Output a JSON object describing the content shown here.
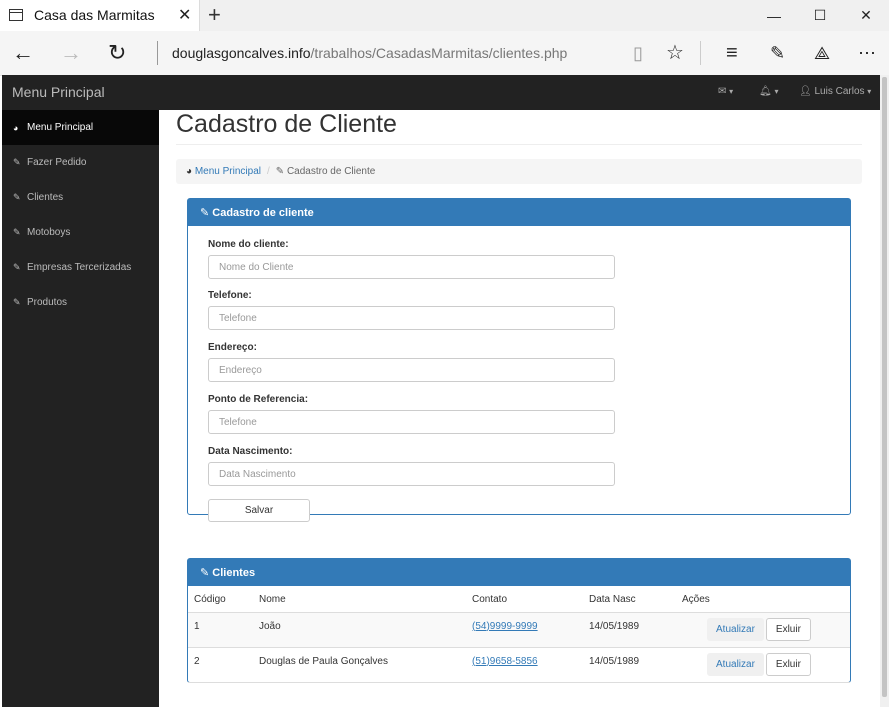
{
  "browser": {
    "tab_title": "Casa das Marmitas",
    "address_host": "douglasgoncalves.info",
    "address_path": "/trabalhos/CasadasMarmitas/clientes.php"
  },
  "topbar": {
    "brand": "Menu Principal",
    "user_name": "Luis Carlos"
  },
  "sidebar": {
    "items": [
      {
        "label": "Menu Principal",
        "icon": "dashboard-icon"
      },
      {
        "label": "Fazer Pedido",
        "icon": "edit-icon"
      },
      {
        "label": "Clientes",
        "icon": "edit-icon"
      },
      {
        "label": "Motoboys",
        "icon": "edit-icon"
      },
      {
        "label": "Empresas Tercerizadas",
        "icon": "edit-icon"
      },
      {
        "label": "Produtos",
        "icon": "edit-icon"
      }
    ]
  },
  "page": {
    "title": "Cadastro de Cliente",
    "breadcrumb_home": "Menu Principal",
    "breadcrumb_current": "Cadastro de Cliente"
  },
  "form": {
    "panel_title": "Cadastro de cliente",
    "fields": [
      {
        "label": "Nome do cliente:",
        "placeholder": "Nome do Cliente"
      },
      {
        "label": "Telefone:",
        "placeholder": "Telefone"
      },
      {
        "label": "Endereço:",
        "placeholder": "Endereço"
      },
      {
        "label": "Ponto de Referencia:",
        "placeholder": "Telefone"
      },
      {
        "label": "Data Nascimento:",
        "placeholder": "Data Nascimento"
      }
    ],
    "save_label": "Salvar"
  },
  "clients": {
    "panel_title": "Clientes",
    "columns": [
      "Código",
      "Nome",
      "Contato",
      "Data Nasc",
      "Ações"
    ],
    "rows": [
      {
        "code": "1",
        "name": "João",
        "contact": "(54)9999-9999",
        "birth": "14/05/1989"
      },
      {
        "code": "2",
        "name": "Douglas de Paula Gonçalves",
        "contact": "(51)9658-5856",
        "birth": "14/05/1989"
      }
    ],
    "update_label": "Atualizar",
    "delete_label": "Exluir"
  },
  "colors": {
    "primary": "#337ab7",
    "sidebar_bg": "#222222",
    "sidebar_active_bg": "#080808"
  }
}
